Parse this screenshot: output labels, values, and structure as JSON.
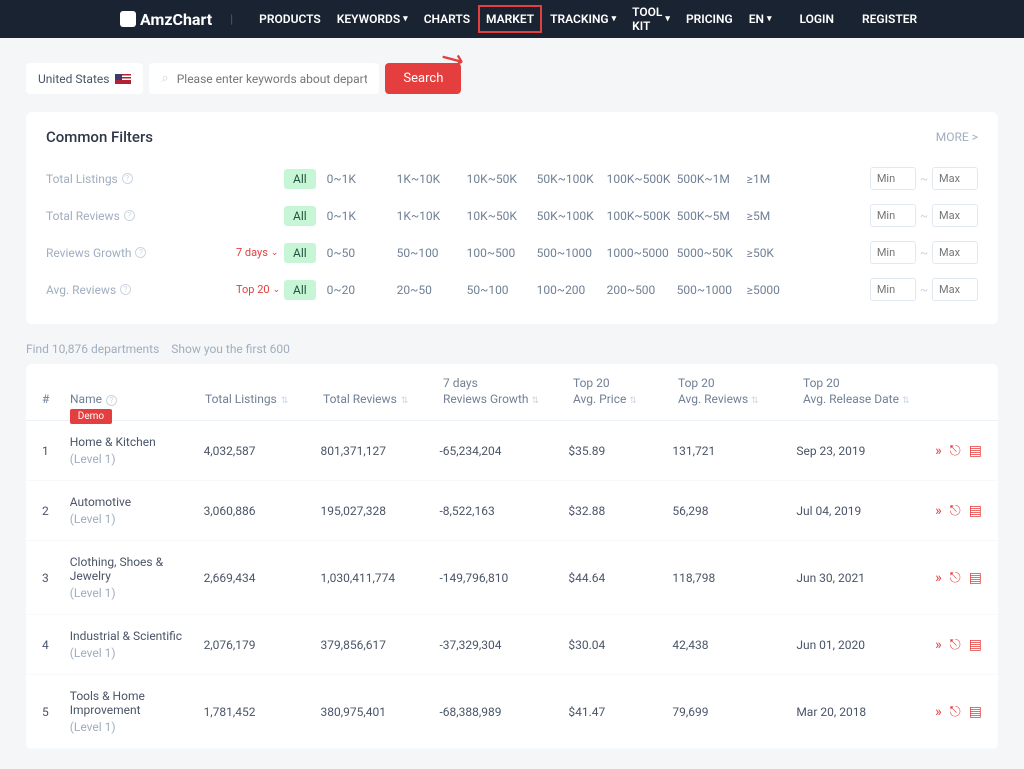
{
  "nav": {
    "brand": "AmzChart",
    "items": [
      "PRODUCTS",
      "KEYWORDS",
      "CHARTS",
      "MARKET",
      "TRACKING",
      "TOOL KIT",
      "PRICING"
    ],
    "rightItems": [
      "EN",
      "LOGIN",
      "REGISTER"
    ]
  },
  "search": {
    "country": "United States",
    "placeholder": "Please enter keywords about department",
    "button": "Search"
  },
  "filters": {
    "title": "Common Filters",
    "more": "MORE >",
    "rows": [
      {
        "label": "Total Listings",
        "sub": "",
        "opts": [
          "All",
          "0~1K",
          "1K~10K",
          "10K~50K",
          "50K~100K",
          "100K~500K",
          "500K~1M",
          "≥1M"
        ]
      },
      {
        "label": "Total Reviews",
        "sub": "",
        "opts": [
          "All",
          "0~1K",
          "1K~10K",
          "10K~50K",
          "50K~100K",
          "100K~500K",
          "500K~5M",
          "≥5M"
        ]
      },
      {
        "label": "Reviews Growth",
        "sub": "7 days",
        "opts": [
          "All",
          "0~50",
          "50~100",
          "100~500",
          "500~1000",
          "1000~5000",
          "5000~50K",
          "≥50K"
        ]
      },
      {
        "label": "Avg. Reviews",
        "sub": "Top 20",
        "opts": [
          "All",
          "0~20",
          "20~50",
          "50~100",
          "100~200",
          "200~500",
          "500~1000",
          "≥5000"
        ]
      }
    ],
    "min": "Min",
    "max": "Max"
  },
  "results": {
    "found": "Find 10,876 departments",
    "show": "Show you the first 600"
  },
  "table": {
    "headers": {
      "num": "#",
      "name": "Name",
      "listings": "Total Listings",
      "reviews": "Total Reviews",
      "growth1": "7 days",
      "growth2": "Reviews Growth",
      "price1": "Top 20",
      "price2": "Avg. Price",
      "avgrev1": "Top 20",
      "avgrev2": "Avg. Reviews",
      "date1": "Top 20",
      "date2": "Avg. Release Date"
    },
    "demo": "Demo",
    "rows": [
      {
        "num": "1",
        "name": "Home & Kitchen",
        "level": "(Level 1)",
        "listings": "4,032,587",
        "reviews": "801,371,127",
        "growth": "-65,234,204",
        "price": "$35.89",
        "avgrev": "131,721",
        "date": "Sep 23, 2019"
      },
      {
        "num": "2",
        "name": "Automotive",
        "level": "(Level 1)",
        "listings": "3,060,886",
        "reviews": "195,027,328",
        "growth": "-8,522,163",
        "price": "$32.88",
        "avgrev": "56,298",
        "date": "Jul 04, 2019"
      },
      {
        "num": "3",
        "name": "Clothing, Shoes & Jewelry",
        "level": "(Level 1)",
        "listings": "2,669,434",
        "reviews": "1,030,411,774",
        "growth": "-149,796,810",
        "price": "$44.64",
        "avgrev": "118,798",
        "date": "Jun 30, 2021"
      },
      {
        "num": "4",
        "name": "Industrial & Scientific",
        "level": "(Level 1)",
        "listings": "2,076,179",
        "reviews": "379,856,617",
        "growth": "-37,329,304",
        "price": "$30.04",
        "avgrev": "42,438",
        "date": "Jun 01, 2020"
      },
      {
        "num": "5",
        "name": "Tools & Home Improvement",
        "level": "(Level 1)",
        "listings": "1,781,452",
        "reviews": "380,975,401",
        "growth": "-68,388,989",
        "price": "$41.47",
        "avgrev": "79,699",
        "date": "Mar 20, 2018"
      }
    ]
  }
}
